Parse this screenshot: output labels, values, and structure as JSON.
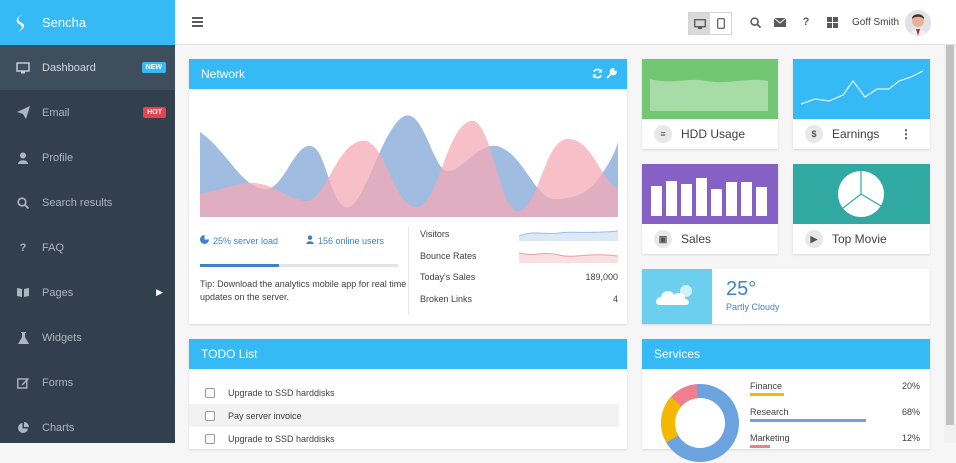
{
  "app": {
    "name": "Sencha"
  },
  "sidebar": {
    "items": [
      {
        "label": "Dashboard",
        "badge": "NEW"
      },
      {
        "label": "Email",
        "badge": "HOT"
      },
      {
        "label": "Profile"
      },
      {
        "label": "Search results"
      },
      {
        "label": "FAQ"
      },
      {
        "label": "Pages"
      },
      {
        "label": "Widgets"
      },
      {
        "label": "Forms"
      },
      {
        "label": "Charts"
      }
    ]
  },
  "header": {
    "user_name": "Goff Smith",
    "help_glyph": "?"
  },
  "network": {
    "title": "Network",
    "server_load": "25% server load",
    "online_users": "156 online users",
    "tip": "Tip: Download the analytics mobile app for real time updates on the server.",
    "progress": 0.4,
    "stats": [
      {
        "label": "Visitors",
        "value": ""
      },
      {
        "label": "Bounce Rates",
        "value": ""
      },
      {
        "label": "Today's Sales",
        "value": "189,000"
      },
      {
        "label": "Broken Links",
        "value": "4"
      }
    ]
  },
  "tiles": {
    "hdd": {
      "label": "HDD Usage",
      "color": "#73c774"
    },
    "earnings": {
      "label": "Earnings",
      "color": "#35baf6"
    },
    "sales": {
      "label": "Sales",
      "color": "#8661c5"
    },
    "movie": {
      "label": "Top Movie",
      "color": "#30a9a3"
    }
  },
  "weather": {
    "temp": "25°",
    "desc": "Partly Cloudy"
  },
  "todo": {
    "title": "TODO List",
    "items": [
      {
        "label": "Upgrade to SSD harddisks"
      },
      {
        "label": "Pay server invoice"
      },
      {
        "label": "Upgrade to SSD harddisks"
      }
    ]
  },
  "services": {
    "title": "Services",
    "items": [
      {
        "label": "Finance",
        "percent": "20%",
        "value": 0.2,
        "color": "#f5b800"
      },
      {
        "label": "Research",
        "percent": "68%",
        "value": 0.68,
        "color": "#6aa3dd"
      },
      {
        "label": "Marketing",
        "percent": "12%",
        "value": 0.12,
        "color": "#f07f8e"
      }
    ]
  },
  "icons": [
    "menu-icon",
    "desktop-icon",
    "tablet-icon",
    "search-icon",
    "envelope-icon",
    "help-icon",
    "grid-icon",
    "refresh-icon",
    "wrench-icon",
    "pie-icon",
    "user-icon",
    "database-icon",
    "dollar-icon",
    "more-icon",
    "briefcase-icon",
    "video-icon",
    "cloud-icon"
  ]
}
